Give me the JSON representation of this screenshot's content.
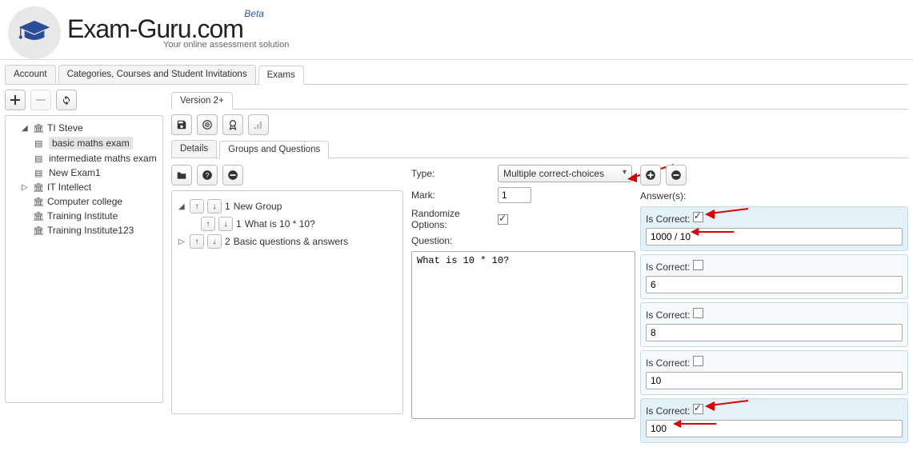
{
  "brand": {
    "title": "Exam-Guru.com",
    "beta": "Beta",
    "tagline": "Your online assessment solution"
  },
  "main_tabs": {
    "account": "Account",
    "categories": "Categories, Courses and Student Invitations",
    "exams": "Exams"
  },
  "version_tab": "Version 2+",
  "detail_tabs": {
    "details": "Details",
    "groups": "Groups and Questions"
  },
  "sidebar": {
    "tree": [
      {
        "label": "TI Steve",
        "expanded": true,
        "children": [
          {
            "label": "basic maths exam",
            "selected": true
          },
          {
            "label": "intermediate maths exam"
          },
          {
            "label": "New Exam1"
          }
        ]
      },
      {
        "label": "IT Intellect",
        "caret": "▷"
      },
      {
        "label": "Computer college"
      },
      {
        "label": "Training Institute"
      },
      {
        "label": "Training Institute123"
      }
    ]
  },
  "groups_tree": {
    "items": [
      {
        "num": "1",
        "label": "New Group",
        "expanded": true,
        "children": [
          {
            "num": "1",
            "label": "What is 10 * 10?"
          }
        ]
      },
      {
        "num": "2",
        "label": "Basic questions & answers",
        "expanded": false
      }
    ]
  },
  "question_panel": {
    "type_label": "Type:",
    "type_value": "Multiple correct-choices",
    "mark_label": "Mark:",
    "mark_value": "1",
    "randomize_label": "Randomize Options:",
    "randomize_checked": true,
    "question_label": "Question:",
    "question_text": "What is 10 * 10?"
  },
  "answers": {
    "header": "Answer(s):",
    "is_correct_label": "Is Correct:",
    "items": [
      {
        "correct": true,
        "value": "1000 / 10"
      },
      {
        "correct": false,
        "value": "6"
      },
      {
        "correct": false,
        "value": "8"
      },
      {
        "correct": false,
        "value": "10"
      },
      {
        "correct": true,
        "value": "100"
      }
    ]
  }
}
